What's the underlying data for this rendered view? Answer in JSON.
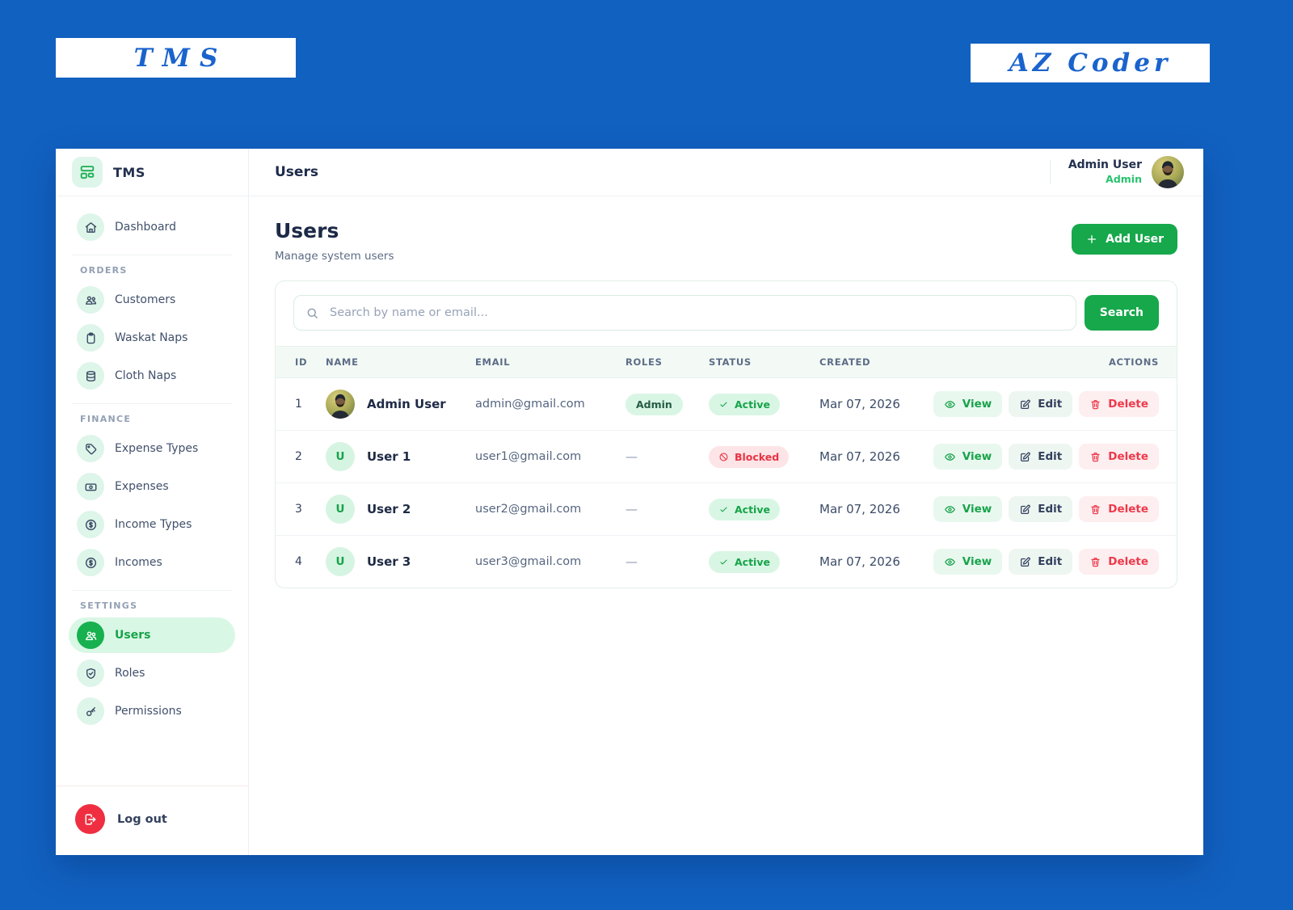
{
  "brand": {
    "left": "TMS",
    "right": "AZ Coder"
  },
  "colors": {
    "background_blue": "#1161c1",
    "brand_blue": "#1a63cd",
    "primary_green": "#16a84b",
    "light_green": "#def5e9",
    "active_green_text": "#17a34a",
    "danger_red": "#ee3a4a",
    "light_red": "#fdecee",
    "navy_text": "#1c2947"
  },
  "sidebar": {
    "logo_text": "TMS",
    "logo_icon": "layout-icon",
    "sections": [
      {
        "label": null,
        "items": [
          {
            "key": "dashboard",
            "label": "Dashboard",
            "icon": "home-icon",
            "active": false
          }
        ]
      },
      {
        "label": "ORDERS",
        "items": [
          {
            "key": "customers",
            "label": "Customers",
            "icon": "customers-icon",
            "active": false
          },
          {
            "key": "waskat-naps",
            "label": "Waskat Naps",
            "icon": "clipboard-icon",
            "active": false
          },
          {
            "key": "cloth-naps",
            "label": "Cloth Naps",
            "icon": "database-icon",
            "active": false
          }
        ]
      },
      {
        "label": "FINANCE",
        "items": [
          {
            "key": "expense-types",
            "label": "Expense Types",
            "icon": "tag-icon",
            "active": false
          },
          {
            "key": "expenses",
            "label": "Expenses",
            "icon": "banknote-icon",
            "active": false
          },
          {
            "key": "income-types",
            "label": "Income Types",
            "icon": "dollar-circle-icon",
            "active": false
          },
          {
            "key": "incomes",
            "label": "Incomes",
            "icon": "dollar-circle-icon",
            "active": false
          }
        ]
      },
      {
        "label": "SETTINGS",
        "items": [
          {
            "key": "users",
            "label": "Users",
            "icon": "users-icon",
            "active": true
          },
          {
            "key": "roles",
            "label": "Roles",
            "icon": "shield-check-icon",
            "active": false
          },
          {
            "key": "permissions",
            "label": "Permissions",
            "icon": "key-icon",
            "active": false
          }
        ]
      }
    ],
    "logout": {
      "label": "Log out",
      "icon": "logout-icon"
    }
  },
  "header": {
    "title": "Users",
    "user_name": "Admin User",
    "user_role": "Admin"
  },
  "page": {
    "title": "Users",
    "subtitle": "Manage system users",
    "add_user_label": "Add User",
    "search_placeholder": "Search by name or email...",
    "search_label": "Search"
  },
  "table": {
    "columns": [
      "ID",
      "NAME",
      "EMAIL",
      "ROLES",
      "STATUS",
      "CREATED",
      "ACTIONS"
    ],
    "empty_role_text": "—",
    "action_labels": {
      "view": "View",
      "edit": "Edit",
      "delete": "Delete"
    },
    "rows": [
      {
        "id": "1",
        "name": "Admin User",
        "email": "admin@gmail.com",
        "role": "Admin",
        "status": {
          "label": "Active",
          "type": "active"
        },
        "created": "Mar 07, 2026",
        "avatar": {
          "type": "photo"
        }
      },
      {
        "id": "2",
        "name": "User 1",
        "email": "user1@gmail.com",
        "role": "—",
        "status": {
          "label": "Blocked",
          "type": "blocked"
        },
        "created": "Mar 07, 2026",
        "avatar": {
          "type": "initial",
          "text": "U"
        }
      },
      {
        "id": "3",
        "name": "User 2",
        "email": "user2@gmail.com",
        "role": "—",
        "status": {
          "label": "Active",
          "type": "active"
        },
        "created": "Mar 07, 2026",
        "avatar": {
          "type": "initial",
          "text": "U"
        }
      },
      {
        "id": "4",
        "name": "User 3",
        "email": "user3@gmail.com",
        "role": "—",
        "status": {
          "label": "Active",
          "type": "active"
        },
        "created": "Mar 07, 2026",
        "avatar": {
          "type": "initial",
          "text": "U"
        }
      }
    ]
  }
}
